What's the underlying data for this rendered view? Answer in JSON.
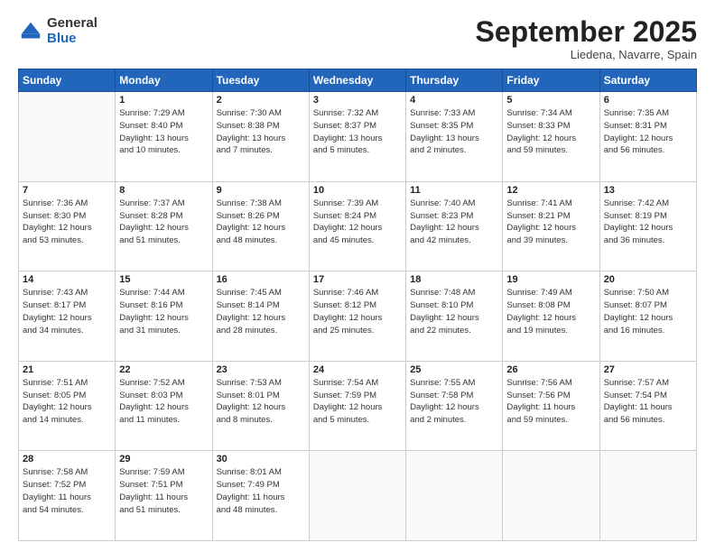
{
  "header": {
    "logo_general": "General",
    "logo_blue": "Blue",
    "month": "September 2025",
    "location": "Liedena, Navarre, Spain"
  },
  "weekdays": [
    "Sunday",
    "Monday",
    "Tuesday",
    "Wednesday",
    "Thursday",
    "Friday",
    "Saturday"
  ],
  "rows": [
    [
      {
        "day": "",
        "lines": []
      },
      {
        "day": "1",
        "lines": [
          "Sunrise: 7:29 AM",
          "Sunset: 8:40 PM",
          "Daylight: 13 hours",
          "and 10 minutes."
        ]
      },
      {
        "day": "2",
        "lines": [
          "Sunrise: 7:30 AM",
          "Sunset: 8:38 PM",
          "Daylight: 13 hours",
          "and 7 minutes."
        ]
      },
      {
        "day": "3",
        "lines": [
          "Sunrise: 7:32 AM",
          "Sunset: 8:37 PM",
          "Daylight: 13 hours",
          "and 5 minutes."
        ]
      },
      {
        "day": "4",
        "lines": [
          "Sunrise: 7:33 AM",
          "Sunset: 8:35 PM",
          "Daylight: 13 hours",
          "and 2 minutes."
        ]
      },
      {
        "day": "5",
        "lines": [
          "Sunrise: 7:34 AM",
          "Sunset: 8:33 PM",
          "Daylight: 12 hours",
          "and 59 minutes."
        ]
      },
      {
        "day": "6",
        "lines": [
          "Sunrise: 7:35 AM",
          "Sunset: 8:31 PM",
          "Daylight: 12 hours",
          "and 56 minutes."
        ]
      }
    ],
    [
      {
        "day": "7",
        "lines": [
          "Sunrise: 7:36 AM",
          "Sunset: 8:30 PM",
          "Daylight: 12 hours",
          "and 53 minutes."
        ]
      },
      {
        "day": "8",
        "lines": [
          "Sunrise: 7:37 AM",
          "Sunset: 8:28 PM",
          "Daylight: 12 hours",
          "and 51 minutes."
        ]
      },
      {
        "day": "9",
        "lines": [
          "Sunrise: 7:38 AM",
          "Sunset: 8:26 PM",
          "Daylight: 12 hours",
          "and 48 minutes."
        ]
      },
      {
        "day": "10",
        "lines": [
          "Sunrise: 7:39 AM",
          "Sunset: 8:24 PM",
          "Daylight: 12 hours",
          "and 45 minutes."
        ]
      },
      {
        "day": "11",
        "lines": [
          "Sunrise: 7:40 AM",
          "Sunset: 8:23 PM",
          "Daylight: 12 hours",
          "and 42 minutes."
        ]
      },
      {
        "day": "12",
        "lines": [
          "Sunrise: 7:41 AM",
          "Sunset: 8:21 PM",
          "Daylight: 12 hours",
          "and 39 minutes."
        ]
      },
      {
        "day": "13",
        "lines": [
          "Sunrise: 7:42 AM",
          "Sunset: 8:19 PM",
          "Daylight: 12 hours",
          "and 36 minutes."
        ]
      }
    ],
    [
      {
        "day": "14",
        "lines": [
          "Sunrise: 7:43 AM",
          "Sunset: 8:17 PM",
          "Daylight: 12 hours",
          "and 34 minutes."
        ]
      },
      {
        "day": "15",
        "lines": [
          "Sunrise: 7:44 AM",
          "Sunset: 8:16 PM",
          "Daylight: 12 hours",
          "and 31 minutes."
        ]
      },
      {
        "day": "16",
        "lines": [
          "Sunrise: 7:45 AM",
          "Sunset: 8:14 PM",
          "Daylight: 12 hours",
          "and 28 minutes."
        ]
      },
      {
        "day": "17",
        "lines": [
          "Sunrise: 7:46 AM",
          "Sunset: 8:12 PM",
          "Daylight: 12 hours",
          "and 25 minutes."
        ]
      },
      {
        "day": "18",
        "lines": [
          "Sunrise: 7:48 AM",
          "Sunset: 8:10 PM",
          "Daylight: 12 hours",
          "and 22 minutes."
        ]
      },
      {
        "day": "19",
        "lines": [
          "Sunrise: 7:49 AM",
          "Sunset: 8:08 PM",
          "Daylight: 12 hours",
          "and 19 minutes."
        ]
      },
      {
        "day": "20",
        "lines": [
          "Sunrise: 7:50 AM",
          "Sunset: 8:07 PM",
          "Daylight: 12 hours",
          "and 16 minutes."
        ]
      }
    ],
    [
      {
        "day": "21",
        "lines": [
          "Sunrise: 7:51 AM",
          "Sunset: 8:05 PM",
          "Daylight: 12 hours",
          "and 14 minutes."
        ]
      },
      {
        "day": "22",
        "lines": [
          "Sunrise: 7:52 AM",
          "Sunset: 8:03 PM",
          "Daylight: 12 hours",
          "and 11 minutes."
        ]
      },
      {
        "day": "23",
        "lines": [
          "Sunrise: 7:53 AM",
          "Sunset: 8:01 PM",
          "Daylight: 12 hours",
          "and 8 minutes."
        ]
      },
      {
        "day": "24",
        "lines": [
          "Sunrise: 7:54 AM",
          "Sunset: 7:59 PM",
          "Daylight: 12 hours",
          "and 5 minutes."
        ]
      },
      {
        "day": "25",
        "lines": [
          "Sunrise: 7:55 AM",
          "Sunset: 7:58 PM",
          "Daylight: 12 hours",
          "and 2 minutes."
        ]
      },
      {
        "day": "26",
        "lines": [
          "Sunrise: 7:56 AM",
          "Sunset: 7:56 PM",
          "Daylight: 11 hours",
          "and 59 minutes."
        ]
      },
      {
        "day": "27",
        "lines": [
          "Sunrise: 7:57 AM",
          "Sunset: 7:54 PM",
          "Daylight: 11 hours",
          "and 56 minutes."
        ]
      }
    ],
    [
      {
        "day": "28",
        "lines": [
          "Sunrise: 7:58 AM",
          "Sunset: 7:52 PM",
          "Daylight: 11 hours",
          "and 54 minutes."
        ]
      },
      {
        "day": "29",
        "lines": [
          "Sunrise: 7:59 AM",
          "Sunset: 7:51 PM",
          "Daylight: 11 hours",
          "and 51 minutes."
        ]
      },
      {
        "day": "30",
        "lines": [
          "Sunrise: 8:01 AM",
          "Sunset: 7:49 PM",
          "Daylight: 11 hours",
          "and 48 minutes."
        ]
      },
      {
        "day": "",
        "lines": []
      },
      {
        "day": "",
        "lines": []
      },
      {
        "day": "",
        "lines": []
      },
      {
        "day": "",
        "lines": []
      }
    ]
  ]
}
